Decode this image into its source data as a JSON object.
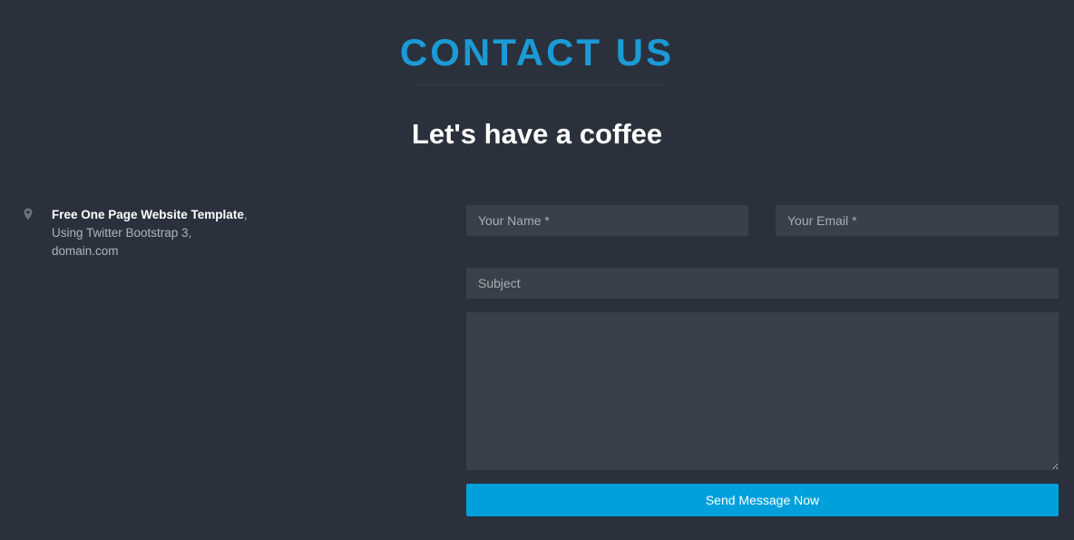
{
  "header": {
    "title": "CONTACT US",
    "subtitle": "Let's have a coffee"
  },
  "address": {
    "icon": "map-marker-icon",
    "line1_strong": "Free One Page Website Template",
    "line1_suffix": ",",
    "line2": "Using Twitter Bootstrap 3,",
    "line3": "domain.com"
  },
  "form": {
    "name_placeholder": "Your Name *",
    "email_placeholder": "Your Email *",
    "subject_placeholder": "Subject",
    "message_placeholder": "",
    "submit_label": "Send Message Now"
  },
  "colors": {
    "background": "#2a313c",
    "accent": "#1b9ad6",
    "button": "#00a0dc",
    "field_background": "#3a4049"
  }
}
